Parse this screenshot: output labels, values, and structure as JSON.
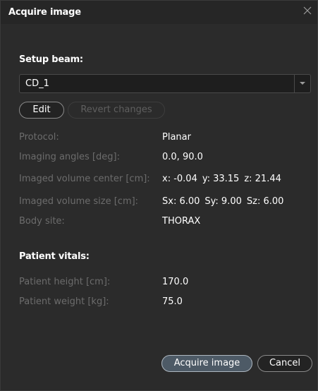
{
  "window": {
    "title": "Acquire image",
    "close_icon": "close-icon"
  },
  "setup": {
    "heading": "Setup beam:",
    "beam_selected": "CD_1",
    "edit_label": "Edit",
    "revert_label": "Revert changes"
  },
  "details": {
    "protocol": {
      "label": "Protocol:",
      "value": "Planar"
    },
    "angles": {
      "label": "Imaging angles [deg]:",
      "value": "0.0, 90.0"
    },
    "center": {
      "label": "Imaged volume center [cm]:",
      "x": "x: -0.04",
      "y": "y: 33.15",
      "z": "z: 21.44"
    },
    "size": {
      "label": "Imaged volume size [cm]:",
      "sx": "Sx: 6.00",
      "sy": "Sy: 9.00",
      "sz": "Sz: 6.00"
    },
    "body_site": {
      "label": "Body site:",
      "value": "THORAX"
    }
  },
  "vitals": {
    "heading": "Patient vitals:",
    "height": {
      "label": "Patient height [cm]:",
      "value": "170.0"
    },
    "weight": {
      "label": "Patient weight [kg]:",
      "value": "75.0"
    }
  },
  "footer": {
    "acquire_label": "Acquire image",
    "cancel_label": "Cancel"
  },
  "colors": {
    "background": "#2b2b2b",
    "label_text": "#6c6c6c",
    "value_text": "#ffffff",
    "primary_button": "#4d5a66"
  }
}
